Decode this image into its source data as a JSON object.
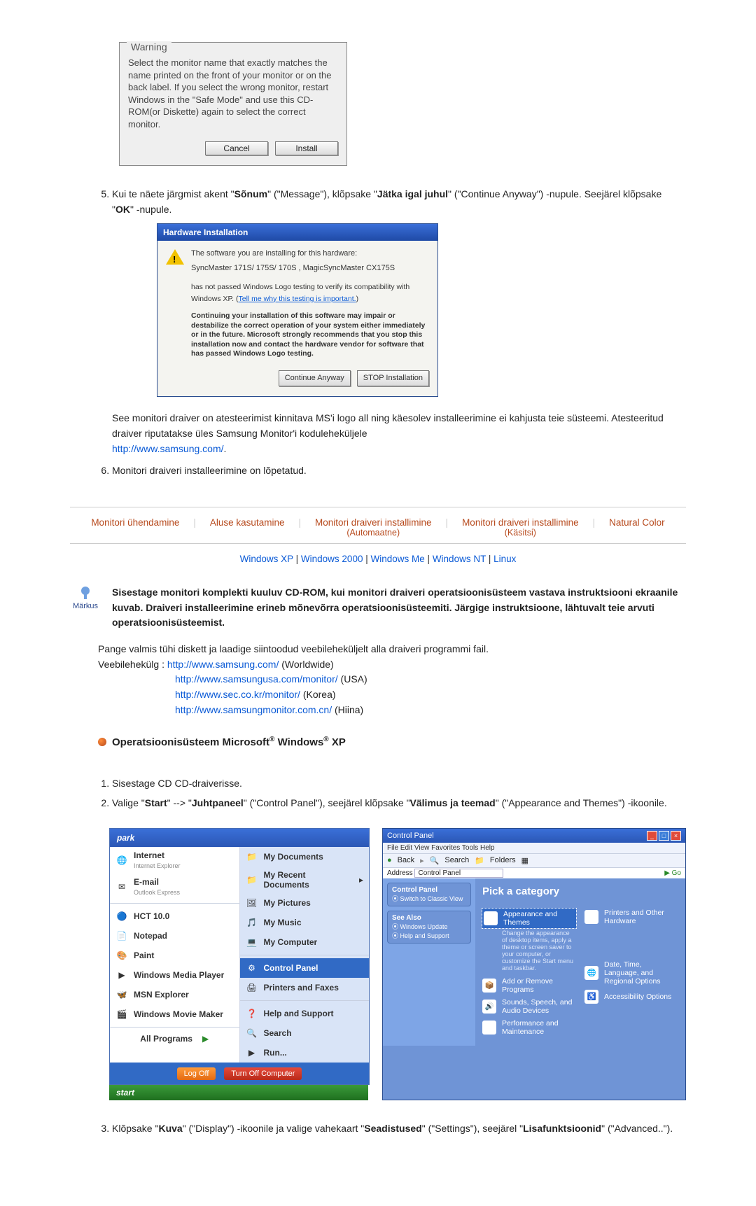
{
  "warning_dialog": {
    "legend": "Warning",
    "body": "Select the monitor name that exactly matches the name printed on the front of your monitor or on the back label. If you select the wrong monitor, restart Windows in the \"Safe Mode\" and use this CD-ROM(or Diskette) again to select the correct monitor.",
    "cancel": "Cancel",
    "install": "Install"
  },
  "step5": {
    "number": "5.",
    "text_before": "Kui te näete järgmist akent \"",
    "msg_bold": "Sõnum",
    "msg_paren": "\" (\"Message\"), klõpsake \"",
    "cont_bold": "Jätka igal juhul",
    "cont_paren": "\" (\"Continue Anyway\") -nupule. Seejärel klõpsake \"",
    "ok_bold": "OK",
    "after": "\" -nupule."
  },
  "hw_dialog": {
    "title": "Hardware Installation",
    "software_line": "The software you are installing for this hardware:",
    "model": "SyncMaster 171S/ 175S/ 170S , MagicSyncMaster CX175S",
    "not_passed": "has not passed Windows Logo testing to verify its compatibility with Windows XP. (",
    "tell_me": "Tell me why this testing is important.",
    "not_passed_close": ")",
    "bold_block": "Continuing your installation of this software may impair or destabilize the correct operation of your system either immediately or in the future. Microsoft strongly recommends that you stop this installation now and contact the hardware vendor for software that has passed Windows Logo testing.",
    "continue_btn": "Continue Anyway",
    "stop_btn": "STOP Installation"
  },
  "after_hw_note": {
    "line1": "See monitori draiver on atesteerimist kinnitava MS'i logo all ning käesolev installeerimine ei kahjusta teie süsteemi. Atesteeritud draiver riputatakse üles Samsung Monitor'i koduleheküljele",
    "link": "http://www.samsung.com/",
    "dot": "."
  },
  "step6": {
    "number": "6.",
    "text": "Monitori draiveri installeerimine on lõpetatud."
  },
  "tabs": {
    "t1": "Monitori ühendamine",
    "t2": "Aluse kasutamine",
    "t3a": "Monitori draiveri installimine",
    "t3b": "(Automaatne)",
    "t4a": "Monitori draiveri installimine",
    "t4b": "(Käsitsi)",
    "t5": "Natural Color"
  },
  "os_links": {
    "xp": "Windows XP",
    "w2k": "Windows 2000",
    "me": "Windows Me",
    "nt": "Windows NT",
    "linux": "Linux",
    "sep": " | "
  },
  "markus": {
    "badge": "Märkus",
    "text": "Sisestage monitori komplekti kuuluv CD-ROM, kui monitori draiveri operatsioonisüsteem vastava instruktsiooni ekraanile kuvab. Draiveri installeerimine erineb mõnevõrra operatsioonisüsteemiti. Järgige instruktsioone, lähtuvalt teie arvuti operatsioonisüsteemist."
  },
  "download": {
    "intro": "Pange valmis tühi diskett ja laadige siintoodud veebileheküljelt alla draiveri programmi fail.",
    "label": "Veebilehekülg :",
    "rows": [
      {
        "url": "http://www.samsung.com/",
        "region": " (Worldwide)"
      },
      {
        "url": "http://www.samsungusa.com/monitor/",
        "region": " (USA)"
      },
      {
        "url": "http://www.sec.co.kr/monitor/",
        "region": " (Korea)"
      },
      {
        "url": "http://www.samsungmonitor.com.cn/",
        "region": " (Hiina)"
      }
    ]
  },
  "os_head": "Operatsioonisüsteem Microsoft® Windows® XP",
  "xp_steps": {
    "s1": "Sisestage CD CD-draiverisse.",
    "s2_a": "Valige \"",
    "s2_start": "Start",
    "s2_b": "\" --> \"",
    "s2_cp": "Juhtpaneel",
    "s2_c": "\" (\"Control Panel\"), seejärel klõpsake \"",
    "s2_theme": "Välimus ja teemad",
    "s2_d": "\" (\"Appearance and Themes\") -ikoonile."
  },
  "start_menu": {
    "header": "park",
    "left": [
      {
        "t": "Internet",
        "s": "Internet Explorer"
      },
      {
        "t": "E-mail",
        "s": "Outlook Express"
      },
      {
        "t": "HCT 10.0",
        "s": ""
      },
      {
        "t": "Notepad",
        "s": ""
      },
      {
        "t": "Paint",
        "s": ""
      },
      {
        "t": "Windows Media Player",
        "s": ""
      },
      {
        "t": "MSN Explorer",
        "s": ""
      },
      {
        "t": "Windows Movie Maker",
        "s": ""
      }
    ],
    "all_programs": "All Programs",
    "right": [
      "My Documents",
      "My Recent Documents",
      "My Pictures",
      "My Music",
      "My Computer",
      "Control Panel",
      "Printers and Faxes",
      "Help and Support",
      "Search",
      "Run..."
    ],
    "right_selected_index": 5,
    "logoff": "Log Off",
    "turnoff": "Turn Off Computer",
    "start": "start"
  },
  "control_panel": {
    "title": "Control Panel",
    "menu": "File   Edit   View   Favorites   Tools   Help",
    "back": "Back",
    "search": "Search",
    "folders": "Folders",
    "address_label": "Address",
    "address_value": "Control Panel",
    "go": "Go",
    "side": {
      "box1_title": "Control Panel",
      "box1_item": "Switch to Classic View",
      "box2_title": "See Also",
      "box2_items": [
        "Windows Update",
        "Help and Support"
      ]
    },
    "pick": "Pick a category",
    "cats": [
      "Appearance and Themes",
      "Printers and Other Hardware",
      "Add or Remove Programs",
      "Date, Time, Language, and Regional Options",
      "Sounds, Speech, and Audio Devices",
      "Accessibility Options",
      "Performance and Maintenance"
    ],
    "sel_desc": "Change the appearance of desktop items, apply a theme or screen saver to your computer, or customize the Start menu and taskbar."
  },
  "step3_final": {
    "a": "Klõpsake \"",
    "kuva": "Kuva",
    "b": "\" (\"Display\") -ikoonile ja valige vahekaart \"",
    "sead": "Seadistused",
    "c": "\" (\"Settings\"), seejärel \"",
    "lisa": "Lisafunktsioonid",
    "d": "\" (\"Advanced..\")."
  }
}
